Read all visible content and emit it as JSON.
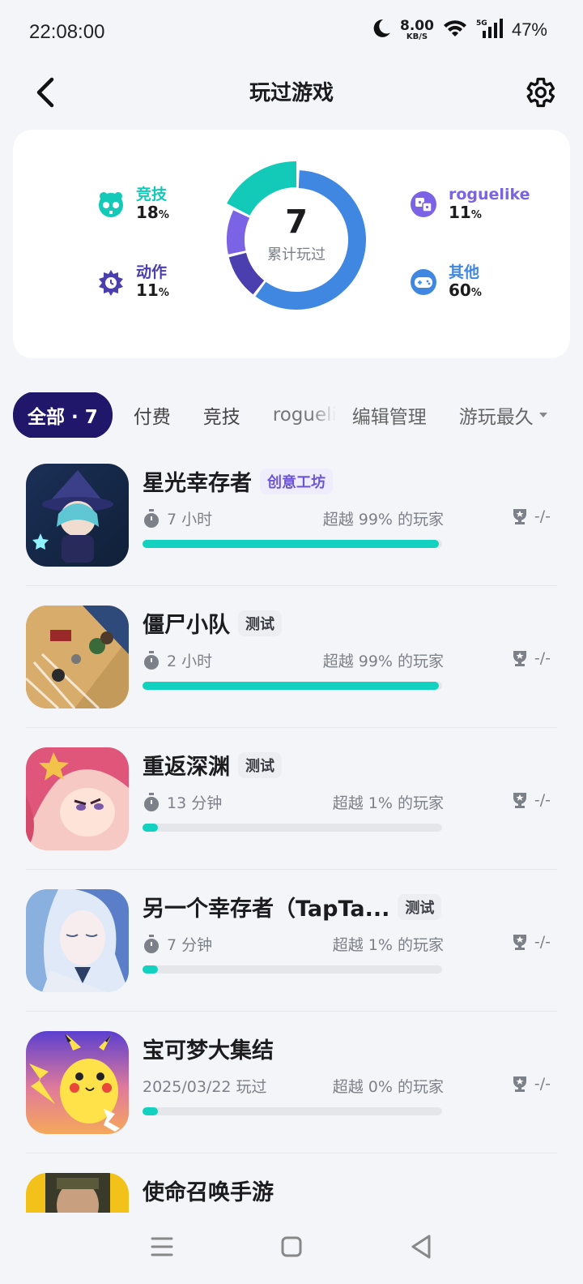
{
  "status": {
    "time": "22:08:00",
    "speed_value": "8.00",
    "speed_unit": "KB/S",
    "battery": "47%"
  },
  "header": {
    "title": "玩过游戏"
  },
  "summary": {
    "total": "7",
    "total_label": "累计玩过",
    "stats": [
      {
        "name": "竞技",
        "percent": "18",
        "color": "#13c9b8",
        "icon": "gamepad-icon"
      },
      {
        "name": "动作",
        "percent": "11",
        "color": "#4b3fb0",
        "icon": "action-icon"
      },
      {
        "name": "roguelike",
        "percent": "11",
        "color": "#7b63e6",
        "icon": "dice-icon"
      },
      {
        "name": "其他",
        "percent": "60",
        "color": "#3f87e0",
        "icon": "controller-icon"
      }
    ],
    "percent_sign": "%"
  },
  "tabs": [
    {
      "label": "全部 · 7",
      "active": true
    },
    {
      "label": "付费"
    },
    {
      "label": "竞技"
    },
    {
      "label": "roguelike"
    },
    {
      "label": "编辑管理"
    },
    {
      "label": "游玩最久"
    }
  ],
  "games": [
    {
      "name": "星光幸存者",
      "badge": "创意工坊",
      "badge_type": "work",
      "time": "7 小时",
      "beat": "超越 99% 的玩家",
      "trophy": "-/-",
      "progress": 0.99,
      "show_timer": true
    },
    {
      "name": "僵尸小队",
      "badge": "测试",
      "badge_type": "test",
      "time": "2 小时",
      "beat": "超越 99% 的玩家",
      "trophy": "-/-",
      "progress": 0.99,
      "show_timer": true
    },
    {
      "name": "重返深渊",
      "badge": "测试",
      "badge_type": "test",
      "time": "13 分钟",
      "beat": "超越 1% 的玩家",
      "trophy": "-/-",
      "progress": 0.05,
      "show_timer": true
    },
    {
      "name": "另一个幸存者（TapTa...",
      "badge": "测试",
      "badge_type": "test",
      "time": "7 分钟",
      "beat": "超越 1% 的玩家",
      "trophy": "-/-",
      "progress": 0.05,
      "show_timer": true
    },
    {
      "name": "宝可梦大集结",
      "badge": "",
      "badge_type": "",
      "time": "2025/03/22 玩过",
      "beat": "超越 0% 的玩家",
      "trophy": "-/-",
      "progress": 0.05,
      "show_timer": false
    },
    {
      "name": "使命召唤手游",
      "badge": "",
      "badge_type": "",
      "time": "",
      "beat": "",
      "trophy": "",
      "progress": 0,
      "show_timer": false
    }
  ]
}
